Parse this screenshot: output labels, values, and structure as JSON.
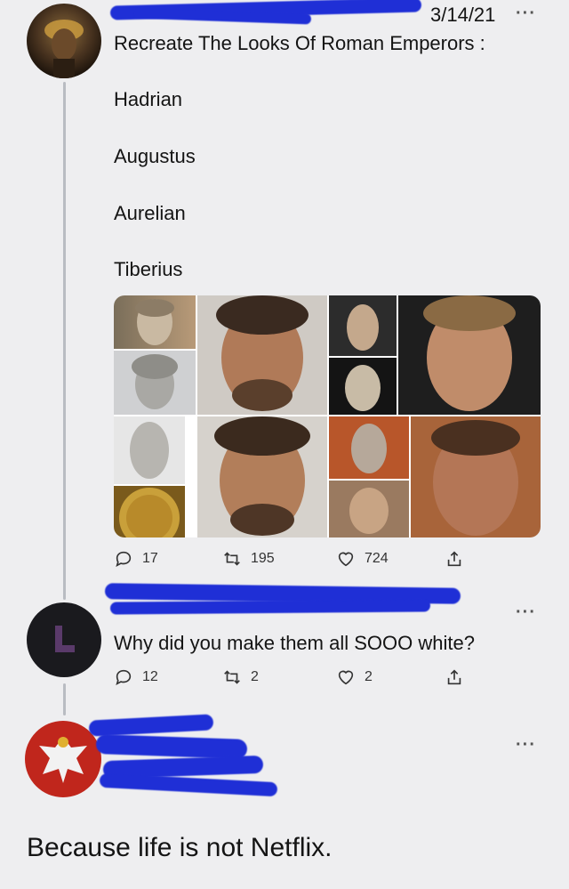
{
  "tweet1": {
    "date": "3/14/21",
    "more_label": "···",
    "title": "Recreate The Looks Of Roman Emperors :",
    "emperors": [
      "Hadrian",
      "Augustus",
      "Aurelian",
      "Tiberius"
    ],
    "replies": "17",
    "retweets": "195",
    "likes": "724"
  },
  "reply1": {
    "more_label": "···",
    "text": "Why did you make them all SOOO white?",
    "replies": "12",
    "retweets": "2",
    "likes": "2"
  },
  "reply2": {
    "more_label": "···",
    "text": "Because life is not Netflix."
  },
  "icons": {
    "reply": "reply-icon",
    "retweet": "retweet-icon",
    "like": "heart-icon",
    "share": "share-icon"
  },
  "colors": {
    "redaction": "#1f2fd6",
    "background": "#eeeef0"
  }
}
